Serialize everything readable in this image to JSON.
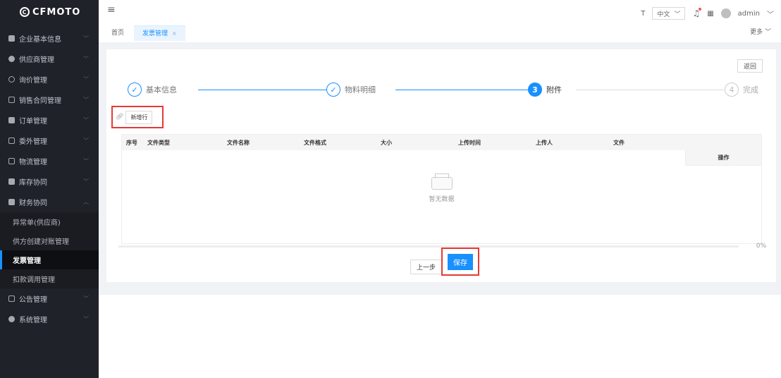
{
  "brand": {
    "name": "CFMOTO"
  },
  "sidebar": {
    "items": [
      {
        "label": "企业基本信息",
        "icon": "building-icon",
        "expanded": false
      },
      {
        "label": "供应商管理",
        "icon": "shield-icon",
        "expanded": false
      },
      {
        "label": "询价管理",
        "icon": "message-icon",
        "expanded": false
      },
      {
        "label": "销售合同管理",
        "icon": "document-icon",
        "expanded": false
      },
      {
        "label": "订单管理",
        "icon": "clipboard-icon",
        "expanded": false
      },
      {
        "label": "委外管理",
        "icon": "truck-icon",
        "expanded": false
      },
      {
        "label": "物流管理",
        "icon": "truck-icon",
        "expanded": false
      },
      {
        "label": "库存协同",
        "icon": "clipboard-icon",
        "expanded": false
      },
      {
        "label": "财务协同",
        "icon": "clipboard-icon",
        "expanded": true
      }
    ],
    "finance_sub": [
      {
        "label": "异常单(供应商)"
      },
      {
        "label": "供方创建对账管理"
      },
      {
        "label": "发票管理",
        "active": true
      },
      {
        "label": "扣款调用管理"
      }
    ],
    "tail_items": [
      {
        "label": "公告管理",
        "icon": "bank-icon"
      },
      {
        "label": "系统管理",
        "icon": "gear-icon"
      }
    ]
  },
  "header": {
    "tabs": [
      {
        "label": "首页"
      },
      {
        "label": "发票管理",
        "active": true
      }
    ],
    "language": "中文",
    "user": "admin",
    "more": "更多"
  },
  "page": {
    "back_label": "返回",
    "steps": [
      {
        "label": "基本信息",
        "status": "done"
      },
      {
        "label": "物料明细",
        "status": "done"
      },
      {
        "num": "3",
        "label": "附件",
        "status": "active"
      },
      {
        "num": "4",
        "label": "完成",
        "status": "wait"
      }
    ],
    "add_row_label": "新增行",
    "table": {
      "columns": [
        "序号",
        "文件类型",
        "文件名称",
        "文件格式",
        "大小",
        "上传时间",
        "上传人",
        "文件"
      ],
      "op_column": "操作",
      "empty_text": "暂无数据"
    },
    "progress_text": "0%",
    "progress_value": 0,
    "prev_label": "上一步",
    "save_label": "保存"
  },
  "colors": {
    "accent": "#1890ff",
    "highlight": "#e53935",
    "sidebar": "#20222a"
  }
}
